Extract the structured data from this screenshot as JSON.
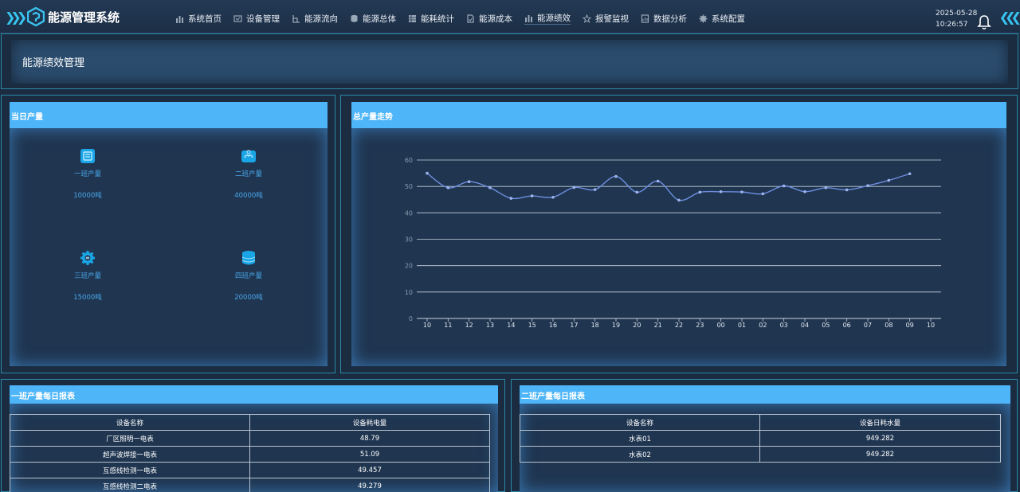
{
  "app": {
    "title": "能源管理系统",
    "date": "2025-05-28",
    "time": "10:26:57"
  },
  "nav": [
    {
      "label": "系统首页",
      "icon": "bar-chart-icon"
    },
    {
      "label": "设备管理",
      "icon": "device-icon"
    },
    {
      "label": "能源流向",
      "icon": "flow-icon"
    },
    {
      "label": "能源总体",
      "icon": "database-icon"
    },
    {
      "label": "能耗统计",
      "icon": "grid-icon"
    },
    {
      "label": "能源成本",
      "icon": "document-icon"
    },
    {
      "label": "能源绩效",
      "icon": "bar-chart-icon"
    },
    {
      "label": "报警监视",
      "icon": "star-icon"
    },
    {
      "label": "数据分析",
      "icon": "doc-chart-icon"
    },
    {
      "label": "系统配置",
      "icon": "gear-icon"
    }
  ],
  "page": {
    "title": "能源绩效管理"
  },
  "daily": {
    "title": "当日产量",
    "items": [
      {
        "label": "一班产量",
        "value": "10000吨",
        "icon": "factory-icon"
      },
      {
        "label": "二班产量",
        "value": "40000吨",
        "icon": "hand-icon"
      },
      {
        "label": "三班产量",
        "value": "15000吨",
        "icon": "gear-icon"
      },
      {
        "label": "四班产量",
        "value": "20000吨",
        "icon": "database-icon"
      }
    ]
  },
  "trend": {
    "title": "总产量走势",
    "chart_data": {
      "type": "line",
      "x": [
        "10",
        "11",
        "12",
        "13",
        "14",
        "15",
        "16",
        "17",
        "18",
        "19",
        "20",
        "21",
        "22",
        "23",
        "00",
        "01",
        "02",
        "03",
        "04",
        "05",
        "06",
        "07",
        "08",
        "09",
        "10"
      ],
      "series": [
        {
          "values": [
            55,
            49.5,
            51.8,
            49.5,
            45.5,
            46.4,
            45.9,
            49.6,
            48.8,
            53.8,
            47.8,
            52,
            44.8,
            47.8,
            48,
            47.9,
            47.2,
            50.2,
            48,
            49.5,
            48.7,
            50.3,
            52.3,
            54.8
          ]
        }
      ],
      "ylim": [
        0,
        60
      ],
      "yticks": [
        0,
        10,
        20,
        30,
        40,
        50,
        60
      ],
      "line_color": "#6e8fe0",
      "grid": true
    }
  },
  "shift1": {
    "title": "一班产量每日报表",
    "headers": [
      "设备名称",
      "设备耗电量"
    ],
    "rows": [
      [
        "厂区照明一电表",
        "48.79"
      ],
      [
        "超声波焊接一电表",
        "51.09"
      ],
      [
        "互感线检测一电表",
        "49.457"
      ],
      [
        "互感线检测二电表",
        "49.279"
      ]
    ]
  },
  "shift2": {
    "title": "二班产量每日报表",
    "headers": [
      "设备名称",
      "设备日耗水量"
    ],
    "rows": [
      [
        "水表01",
        "949.282"
      ],
      [
        "水表02",
        "949.282"
      ]
    ]
  },
  "colors": {
    "accent": "#4db5f8",
    "background": "#1b2b40",
    "border": "#2a8aa8"
  }
}
